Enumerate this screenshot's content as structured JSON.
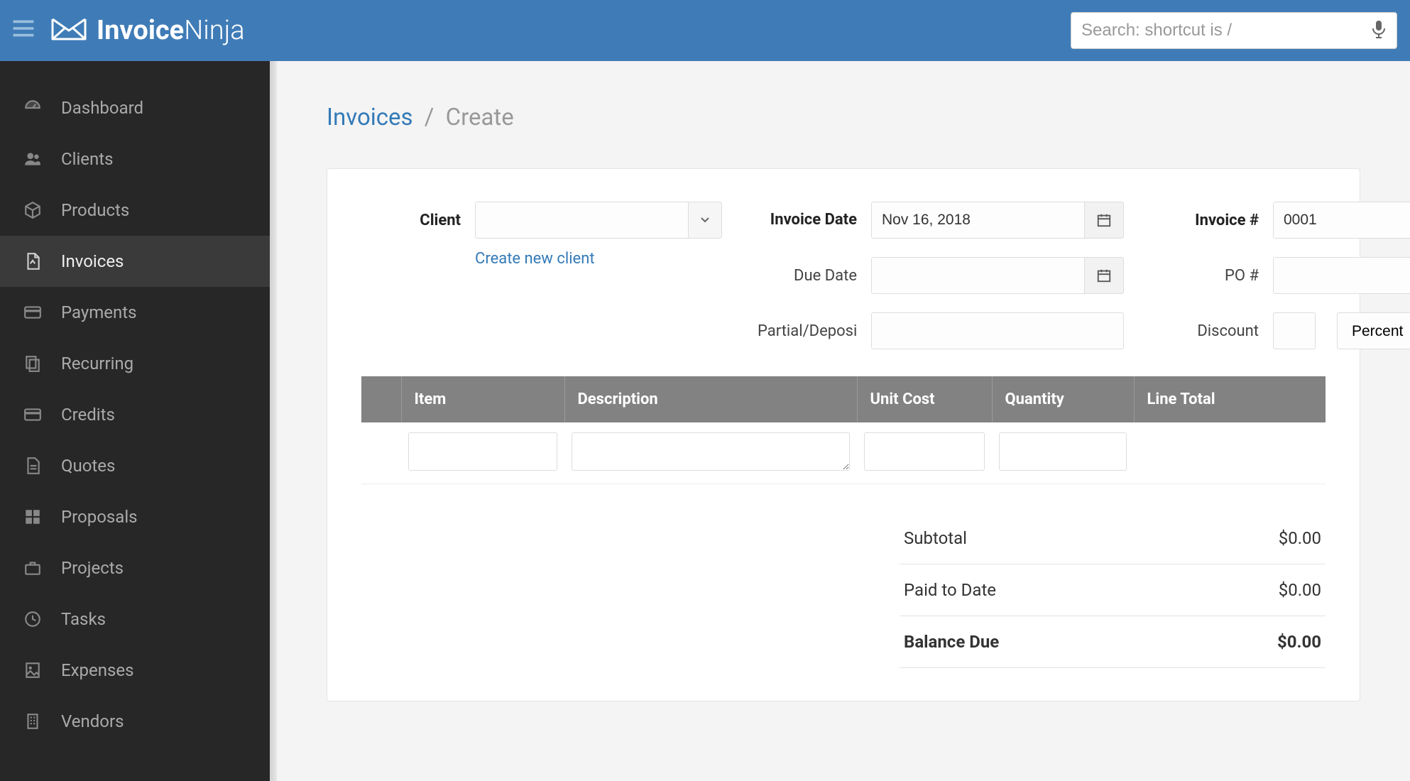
{
  "header": {
    "logo_bold": "Invoice",
    "logo_light": "Ninja",
    "search_placeholder": "Search: shortcut is /"
  },
  "sidebar": {
    "items": [
      {
        "label": "Dashboard",
        "icon": "dashboard"
      },
      {
        "label": "Clients",
        "icon": "clients"
      },
      {
        "label": "Products",
        "icon": "products"
      },
      {
        "label": "Invoices",
        "icon": "invoices",
        "active": true
      },
      {
        "label": "Payments",
        "icon": "payments"
      },
      {
        "label": "Recurring",
        "icon": "recurring"
      },
      {
        "label": "Credits",
        "icon": "credits"
      },
      {
        "label": "Quotes",
        "icon": "quotes"
      },
      {
        "label": "Proposals",
        "icon": "proposals"
      },
      {
        "label": "Projects",
        "icon": "projects"
      },
      {
        "label": "Tasks",
        "icon": "tasks"
      },
      {
        "label": "Expenses",
        "icon": "expenses"
      },
      {
        "label": "Vendors",
        "icon": "vendors"
      }
    ]
  },
  "breadcrumb": {
    "parent": "Invoices",
    "current": "Create"
  },
  "form": {
    "client_label": "Client",
    "client_value": "",
    "create_client_link": "Create new client",
    "invoice_date_label": "Invoice Date",
    "invoice_date_value": "Nov 16, 2018",
    "due_date_label": "Due Date",
    "due_date_value": "",
    "partial_label": "Partial/Deposit",
    "partial_value": "",
    "invoice_num_label": "Invoice #",
    "invoice_num_value": "0001",
    "po_label": "PO #",
    "po_value": "",
    "discount_label": "Discount",
    "discount_amount": "",
    "discount_type": "Percent"
  },
  "table": {
    "cols": [
      "Item",
      "Description",
      "Unit Cost",
      "Quantity",
      "Line Total"
    ],
    "row": {
      "item": "",
      "description": "",
      "unit_cost": "",
      "quantity": "",
      "line_total": ""
    }
  },
  "totals": {
    "subtotal_label": "Subtotal",
    "subtotal_value": "$0.00",
    "paid_label": "Paid to Date",
    "paid_value": "$0.00",
    "balance_label": "Balance Due",
    "balance_value": "$0.00"
  }
}
